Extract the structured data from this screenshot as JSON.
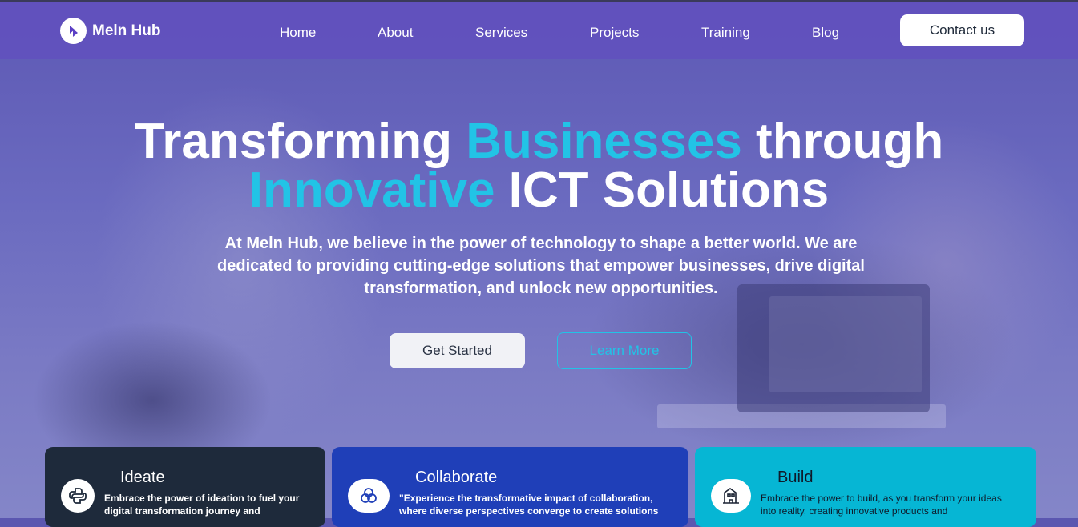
{
  "brand": {
    "name": "Meln Hub"
  },
  "nav": {
    "items": [
      {
        "label": "Home"
      },
      {
        "label": "About"
      },
      {
        "label": "Services"
      },
      {
        "label": "Projects"
      },
      {
        "label": "Training"
      },
      {
        "label": "Blog"
      }
    ],
    "contact_label": "Contact us"
  },
  "hero": {
    "line1_a": "Transforming ",
    "line1_b": "Businesses",
    "line1_c": " through",
    "line2_a": "Innovative",
    "line2_b": " ICT Solutions",
    "subtitle": "At Meln Hub, we believe in the power of technology to shape a better world. We are dedicated to providing cutting-edge solutions that empower businesses, drive digital transformation, and unlock new opportunities.",
    "primary_cta": "Get Started",
    "secondary_cta": "Learn More"
  },
  "cards": [
    {
      "title": "Ideate",
      "text": "Embrace the power of ideation to fuel your digital transformation journey and",
      "icon": "python-icon",
      "color": "#1e2a3b"
    },
    {
      "title": "Collaborate",
      "text": "\"Experience the transformative impact of collaboration, where diverse perspectives converge to create solutions",
      "icon": "circles-icon",
      "color": "#1f3fb8"
    },
    {
      "title": "Build",
      "text": "Embrace the power to build, as you transform your ideas into reality, creating innovative products and",
      "icon": "building-icon",
      "color": "#06b6d4"
    }
  ],
  "colors": {
    "accent": "#22c3e6",
    "nav_bg": "#6250be"
  }
}
